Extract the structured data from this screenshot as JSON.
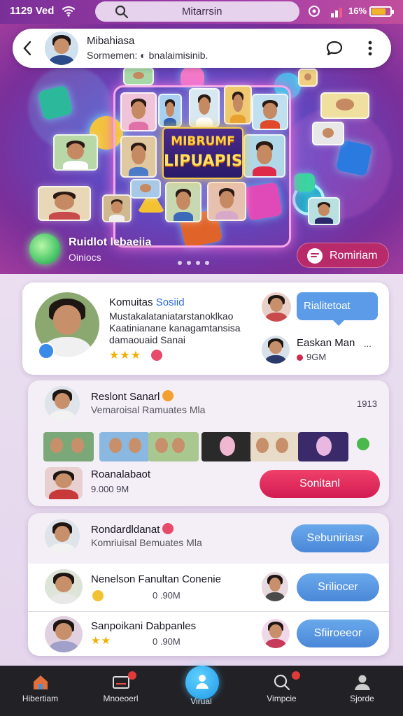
{
  "status_bar": {
    "time": "1129 Ved",
    "search_text": "Mitarrsin",
    "battery": "16%"
  },
  "header": {
    "name": "Mibahiasa",
    "subtitle": "Sormemen: ◐ bnalaimisinib."
  },
  "hero": {
    "title_line1": "MIBRUMF",
    "title_line2": "LIPUAPIS",
    "caption": "Ruidlot lebaeiia",
    "caption_sub": "Oiniocs",
    "button_label": "Romiriam"
  },
  "featured": {
    "title": "Komuitas",
    "title_accent": "Sosiid",
    "line1": "Mustakalataniatarstanoklkao",
    "line2": "Kaatinianane kanagamtansisa",
    "line3": "damaouaid Sanai",
    "bubble": "Rialitetoat",
    "side_name": "Easkan Man",
    "side_meta": "9GM",
    "side_more": "...",
    "rating": "★★★"
  },
  "post1": {
    "name": "Reslont Sanarl",
    "subtitle": "Vemaroisal Ramuates Mla",
    "count": "1913",
    "sub_name": "Roanalabaot",
    "sub_meta": "9.000 9M",
    "button": "Sonitanl"
  },
  "post2": {
    "name": "Rondardldanat",
    "subtitle": "Komriuisal Bemuates Mla",
    "button": "Sebuniriasr",
    "rows": [
      {
        "name": "Nenelson Fanultan Conenie",
        "meta": "0 .90M",
        "button": "Sriliocer"
      },
      {
        "name": "Sanpoikani Dabpanles",
        "meta": "0 .90M",
        "button": "Sfiiroeeor"
      }
    ]
  },
  "bottom_nav": [
    {
      "label": "Hibertiam"
    },
    {
      "label": "Mnoeoerl"
    },
    {
      "label": "Virual"
    },
    {
      "label": "Vimpcie"
    },
    {
      "label": "Sjorde"
    }
  ],
  "colors": {
    "accent_pink": "#d21c52",
    "accent_blue": "#4a88d8",
    "hero_purple": "#7a2f9a",
    "nav_bg": "#222226"
  }
}
